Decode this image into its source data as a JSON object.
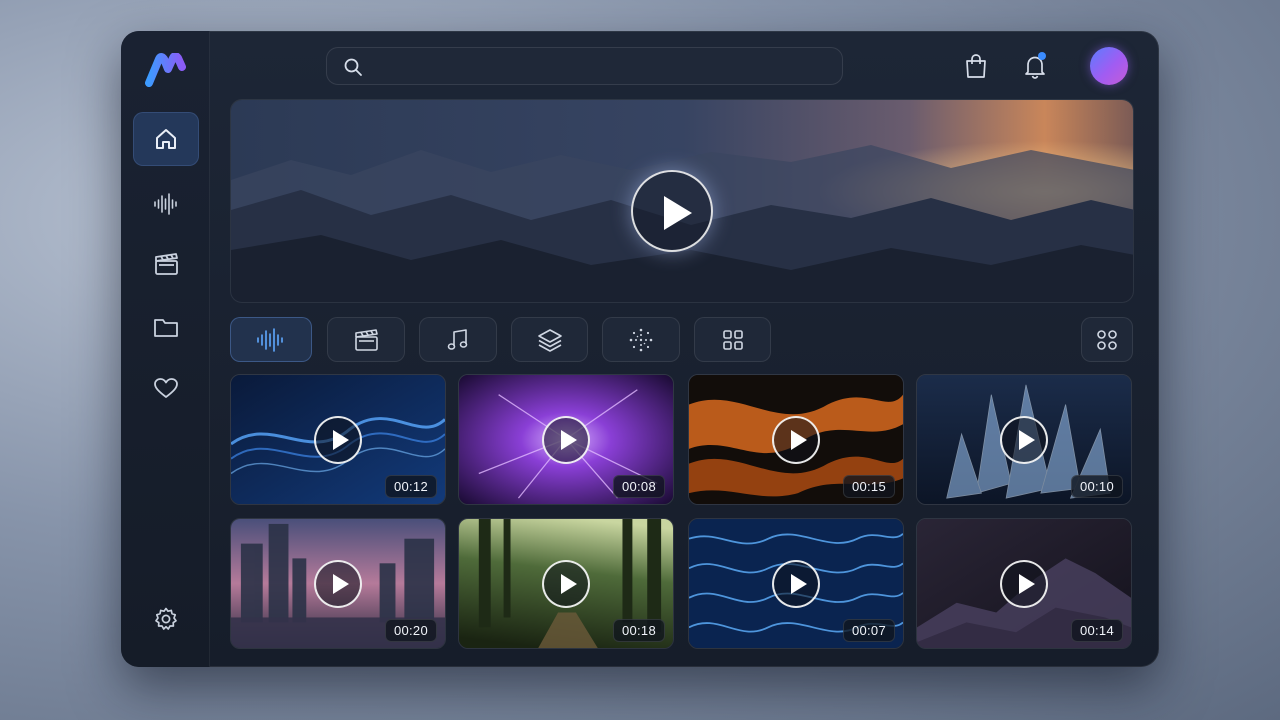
{
  "app": {
    "accent": "#4a90e2",
    "notification_dot": "#3b8cff"
  },
  "search": {
    "placeholder": "",
    "value": ""
  },
  "sidebar": {
    "items": [
      {
        "icon": "home-icon",
        "active": true
      },
      {
        "icon": "audio-wave-icon",
        "active": false
      },
      {
        "icon": "clapperboard-icon",
        "active": false
      },
      {
        "icon": "folder-icon",
        "active": false
      },
      {
        "icon": "heart-icon",
        "active": false
      }
    ],
    "footer_icon": "gear-icon"
  },
  "header": {
    "icons": [
      "shopping-bag-icon",
      "bell-icon"
    ],
    "has_notification": true
  },
  "filters": [
    {
      "icon": "audio-wave-icon",
      "active": true
    },
    {
      "icon": "clapperboard-icon",
      "active": false
    },
    {
      "icon": "music-note-icon",
      "active": false
    },
    {
      "icon": "layers-icon",
      "active": false
    },
    {
      "icon": "particles-icon",
      "active": false
    },
    {
      "icon": "grid-icon",
      "active": false
    }
  ],
  "view_toggle_icon": "grid-icon",
  "videos": [
    {
      "duration": "00:12",
      "theme": "blue-wave"
    },
    {
      "duration": "00:08",
      "theme": "purple-energy"
    },
    {
      "duration": "00:15",
      "theme": "orange-swirl"
    },
    {
      "duration": "00:10",
      "theme": "ice-crystals"
    },
    {
      "duration": "00:20",
      "theme": "city-dusk"
    },
    {
      "duration": "00:18",
      "theme": "forest-path"
    },
    {
      "duration": "00:07",
      "theme": "water-caustics"
    },
    {
      "duration": "00:14",
      "theme": "dark-rock"
    }
  ]
}
